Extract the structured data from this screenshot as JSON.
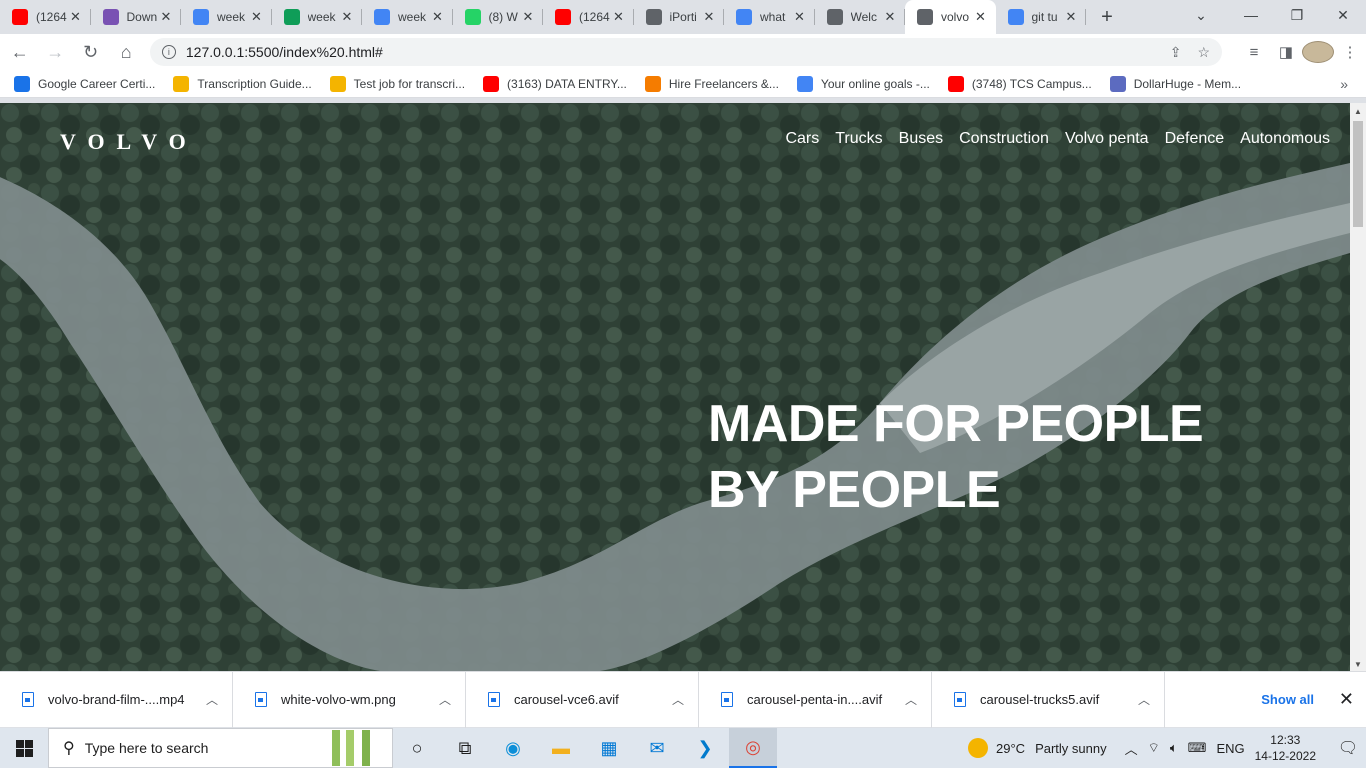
{
  "browser": {
    "tabs": [
      {
        "title": "(1264",
        "icon": "youtube-icon",
        "color": "#ff0000"
      },
      {
        "title": "Down",
        "icon": "bootstrap-icon",
        "color": "#7952b3"
      },
      {
        "title": "week",
        "icon": "google-docs-icon",
        "color": "#4285f4"
      },
      {
        "title": "week",
        "icon": "google-drive-icon",
        "color": "#0f9d58"
      },
      {
        "title": "week",
        "icon": "google-docs-icon",
        "color": "#4285f4"
      },
      {
        "title": "(8) W",
        "icon": "whatsapp-icon",
        "color": "#25d366"
      },
      {
        "title": "(1264",
        "icon": "youtube-icon",
        "color": "#ff0000"
      },
      {
        "title": "iPorti",
        "icon": "globe-icon",
        "color": "#5f6368"
      },
      {
        "title": "what",
        "icon": "google-icon",
        "color": "#4285f4"
      },
      {
        "title": "Welc",
        "icon": "globe-icon",
        "color": "#5f6368"
      },
      {
        "title": "volvo",
        "icon": "globe-icon",
        "color": "#5f6368",
        "active": true
      },
      {
        "title": "git tu",
        "icon": "google-icon",
        "color": "#4285f4"
      }
    ],
    "url": "127.0.0.1:5500/index%20.html#",
    "bookmarks": [
      {
        "label": "Google Career Certi...",
        "icon": "google-icon",
        "color": "#1a73e8"
      },
      {
        "label": "Transcription Guide...",
        "icon": "star-person-icon",
        "color": "#f4b400"
      },
      {
        "label": "Test job for transcri...",
        "icon": "star-person-icon",
        "color": "#f4b400"
      },
      {
        "label": "(3163) DATA ENTRY...",
        "icon": "youtube-icon",
        "color": "#ff0000"
      },
      {
        "label": "Hire Freelancers &...",
        "icon": "freelancer-icon",
        "color": "#f57c00"
      },
      {
        "label": "Your online goals -...",
        "icon": "google-icon",
        "color": "#4285f4"
      },
      {
        "label": "(3748) TCS Campus...",
        "icon": "youtube-icon",
        "color": "#ff0000"
      },
      {
        "label": "DollarHuge - Mem...",
        "icon": "dollarhuge-icon",
        "color": "#5c6bc0"
      }
    ]
  },
  "site": {
    "logo": "VOLVO",
    "nav": [
      "Cars",
      "Trucks",
      "Buses",
      "Construction",
      "Volvo penta",
      "Defence",
      "Autonomous"
    ],
    "hero_line1": "MADE FOR PEOPLE",
    "hero_line2": "BY PEOPLE"
  },
  "downloads": {
    "items": [
      "volvo-brand-film-....mp4",
      "white-volvo-wm.png",
      "carousel-vce6.avif",
      "carousel-penta-in....avif",
      "carousel-trucks5.avif"
    ],
    "show_all": "Show all"
  },
  "taskbar": {
    "search_placeholder": "Type here to search",
    "temperature": "29°C",
    "weather": "Partly sunny",
    "lang": "ENG",
    "time": "12:33",
    "date": "14-12-2022"
  }
}
